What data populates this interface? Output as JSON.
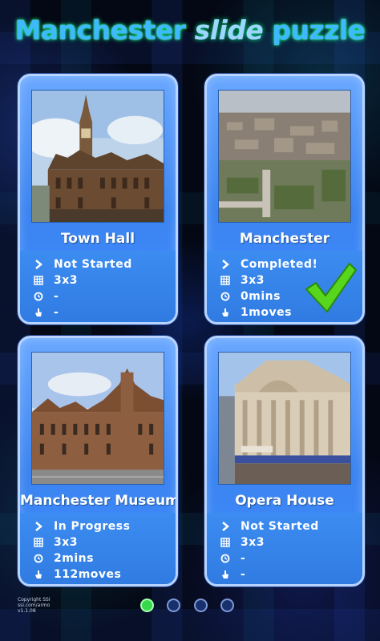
{
  "title": {
    "part1": "Manchester",
    "part2": "slide",
    "part3": "puzzle"
  },
  "colors": {
    "card_fill": "#3b84f0",
    "card_border": "#b8d4ff",
    "active_dot": "#38d84c",
    "check": "#53d11c"
  },
  "puzzles": [
    {
      "name": "Town Hall",
      "status": "Not Started",
      "grid": "3x3",
      "time": "-",
      "moves": "-"
    },
    {
      "name": "Manchester",
      "status": "Completed!",
      "grid": "3x3",
      "time": "0mins",
      "moves": "1moves",
      "completed_icon": "checkmark-icon"
    },
    {
      "name": "Manchester Museum",
      "status": "In Progress",
      "grid": "3x3",
      "time": "2mins",
      "moves": "112moves"
    },
    {
      "name": "Opera House",
      "status": "Not Started",
      "grid": "3x3",
      "time": "-",
      "moves": "-"
    }
  ],
  "icons": {
    "status": "chevron-right-icon",
    "grid": "grid-icon",
    "time": "clock-icon",
    "moves": "hand-icon"
  },
  "pager": {
    "pages": 4,
    "current": 1
  },
  "copyright": {
    "line1": "Copyright SSI",
    "line2": "ssi.com/armo",
    "line3": "v1.1.08"
  }
}
